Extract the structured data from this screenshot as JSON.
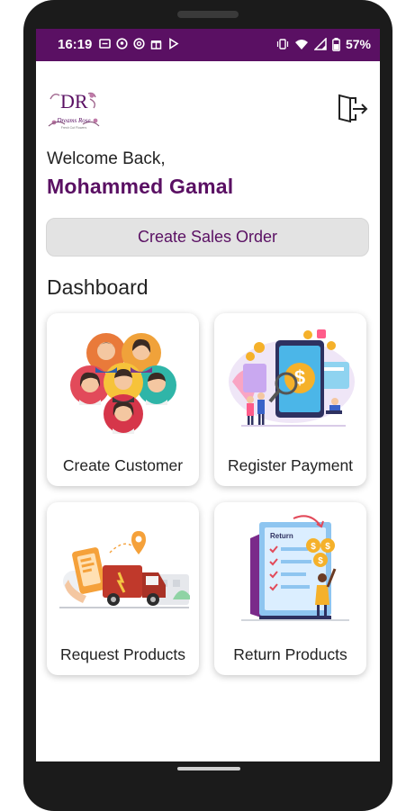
{
  "status_bar": {
    "time": "16:19",
    "battery": "57%",
    "left_icons": [
      "message-icon",
      "pinterest-icon",
      "at-sign-icon",
      "gift-icon",
      "play-icon"
    ],
    "right_icons": [
      "vibrate-icon",
      "wifi-icon",
      "signal-icon",
      "battery-icon"
    ]
  },
  "header": {
    "logo_text": "Dreams Rose",
    "logo_letters": "DR",
    "logo_tagline": "Fresh Cut Flowers",
    "logout_icon": "logout-icon"
  },
  "welcome": {
    "greeting": "Welcome Back,",
    "user_name": "Mohammed Gamal"
  },
  "actions": {
    "create_sales_order": "Create Sales Order"
  },
  "dashboard": {
    "title": "Dashboard",
    "cards": [
      {
        "label": "Create Customer",
        "icon": "customers-illustration"
      },
      {
        "label": "Register Payment",
        "icon": "payment-illustration"
      },
      {
        "label": "Request Products",
        "icon": "delivery-truck-illustration"
      },
      {
        "label": "Return Products",
        "icon": "return-document-illustration"
      }
    ],
    "return_doc_title": "Return"
  },
  "colors": {
    "brand": "#5a1063",
    "button_bg": "#e3e3e3"
  }
}
